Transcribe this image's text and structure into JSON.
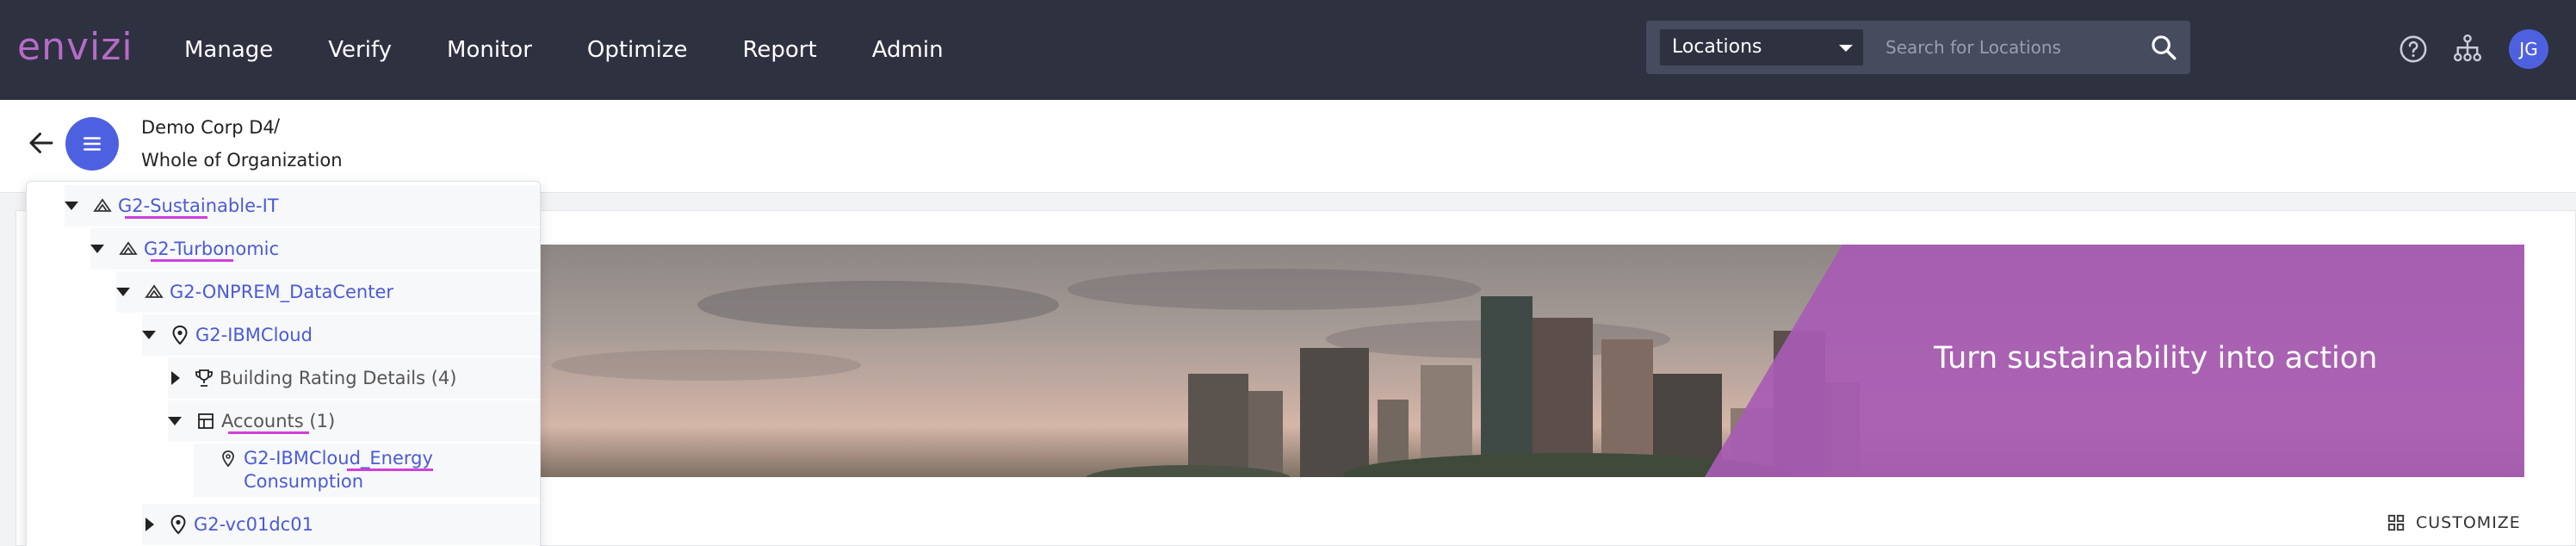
{
  "app": {
    "logo_text": "envizi",
    "brand_color": "#b66bc8",
    "accent_color": "#4d61e0",
    "nav_bg": "#2e3140"
  },
  "nav": {
    "items": [
      "Manage",
      "Verify",
      "Monitor",
      "Optimize",
      "Report",
      "Admin"
    ]
  },
  "search": {
    "scope_label": "Locations",
    "placeholder": "Search for Locations",
    "icon": "search-icon"
  },
  "header_icons": {
    "help": "help-circle-icon",
    "hierarchy": "hierarchy-icon"
  },
  "user": {
    "initials": "JG"
  },
  "breadcrumb": {
    "parent": "Demo Corp D4",
    "separator": "/",
    "current": "Whole of Organization"
  },
  "tree": {
    "items": [
      {
        "label": "G2-Sustainable-IT",
        "icon": "group-icon",
        "expanded": true
      },
      {
        "label": "G2-Turbonomic",
        "icon": "group-icon",
        "expanded": true
      },
      {
        "label": "G2-ONPREM_DataCenter",
        "icon": "group-icon",
        "expanded": true
      },
      {
        "label": "G2-IBMCloud",
        "icon": "location-pin-icon",
        "expanded": true
      },
      {
        "label": "Building Rating Details (4)",
        "icon": "trophy-icon",
        "expanded": false
      },
      {
        "label": "Accounts (1)",
        "icon": "account-icon",
        "expanded": true
      },
      {
        "label": "G2-IBMCloud_Energy",
        "label_line2": "Consumption",
        "icon": "location-outline-icon"
      },
      {
        "label": "G2-vc01dc01",
        "icon": "location-pin-icon",
        "expanded": false
      }
    ]
  },
  "banner": {
    "text": "Turn sustainability into action",
    "overlay_color": "#a85bb4"
  },
  "actions": {
    "customize_label": "CUSTOMIZE",
    "customize_icon": "grid-icon"
  }
}
